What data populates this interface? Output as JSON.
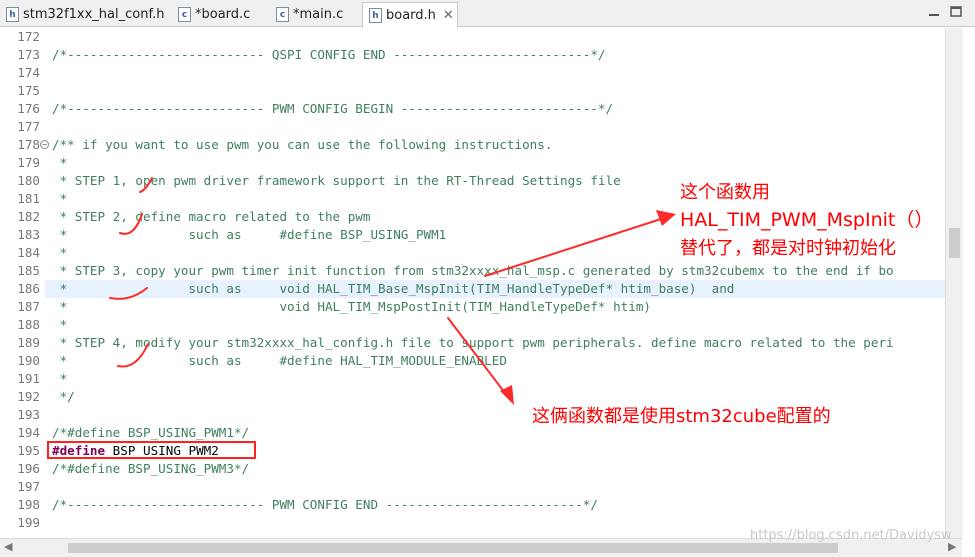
{
  "tabs": [
    {
      "label": "stm32f1xx_hal_conf.h",
      "icon": "h-file-icon",
      "active": false
    },
    {
      "label": "*board.c",
      "icon": "c-file-icon",
      "active": false
    },
    {
      "label": "*main.c",
      "icon": "c-file-icon",
      "active": false
    },
    {
      "label": "board.h",
      "icon": "h-file-icon",
      "active": true
    }
  ],
  "tab_icon_letters": {
    "h": "h",
    "c": "c"
  },
  "editor": {
    "lines": [
      {
        "n": "172",
        "text": ""
      },
      {
        "n": "173",
        "text": "/*-------------------------- QSPI CONFIG END --------------------------*/"
      },
      {
        "n": "174",
        "text": ""
      },
      {
        "n": "175",
        "text": ""
      },
      {
        "n": "176",
        "text": "/*-------------------------- PWM CONFIG BEGIN --------------------------*/"
      },
      {
        "n": "177",
        "text": ""
      },
      {
        "n": "178",
        "text": "/** if you want to use pwm you can use the following instructions."
      },
      {
        "n": "179",
        "text": " *"
      },
      {
        "n": "180",
        "text": " * STEP 1, open pwm driver framework support in the RT-Thread Settings file"
      },
      {
        "n": "181",
        "text": " *"
      },
      {
        "n": "182",
        "text": " * STEP 2, define macro related to the pwm"
      },
      {
        "n": "183",
        "text": " *                such as     #define BSP_USING_PWM1"
      },
      {
        "n": "184",
        "text": " *"
      },
      {
        "n": "185",
        "text": " * STEP 3, copy your pwm timer init function from stm32xxxx_hal_msp.c generated by stm32cubemx to the end if bo"
      },
      {
        "n": "186",
        "text": " *                such as     void HAL_TIM_Base_MspInit(TIM_HandleTypeDef* htim_base)  and"
      },
      {
        "n": "187",
        "text": " *                            void HAL_TIM_MspPostInit(TIM_HandleTypeDef* htim)"
      },
      {
        "n": "188",
        "text": " *"
      },
      {
        "n": "189",
        "text": " * STEP 4, modify your stm32xxxx_hal_config.h file to support pwm peripherals. define macro related to the peri"
      },
      {
        "n": "190",
        "text": " *                such as     #define HAL_TIM_MODULE_ENABLED"
      },
      {
        "n": "191",
        "text": " *"
      },
      {
        "n": "192",
        "text": " */"
      },
      {
        "n": "193",
        "text": ""
      },
      {
        "n": "194",
        "text": "/*#define BSP_USING_PWM1*/"
      },
      {
        "n": "195",
        "kw": "#define",
        "rest": " BSP_USING_PWM2"
      },
      {
        "n": "196",
        "text": "/*#define BSP_USING_PWM3*/"
      },
      {
        "n": "197",
        "text": ""
      },
      {
        "n": "198",
        "text": "/*-------------------------- PWM CONFIG END --------------------------*/"
      },
      {
        "n": "199",
        "text": ""
      }
    ],
    "fold_marker": "−"
  },
  "annotations": {
    "note1": [
      "这个函数用",
      "HAL_TIM_PWM_MspInit（）",
      "替代了，都是对时钟初始化"
    ],
    "note2": "这俩函数都是使用stm32cube配置的",
    "color": "#ff0000"
  },
  "watermark": "https://blog.csdn.net/Davidysw"
}
